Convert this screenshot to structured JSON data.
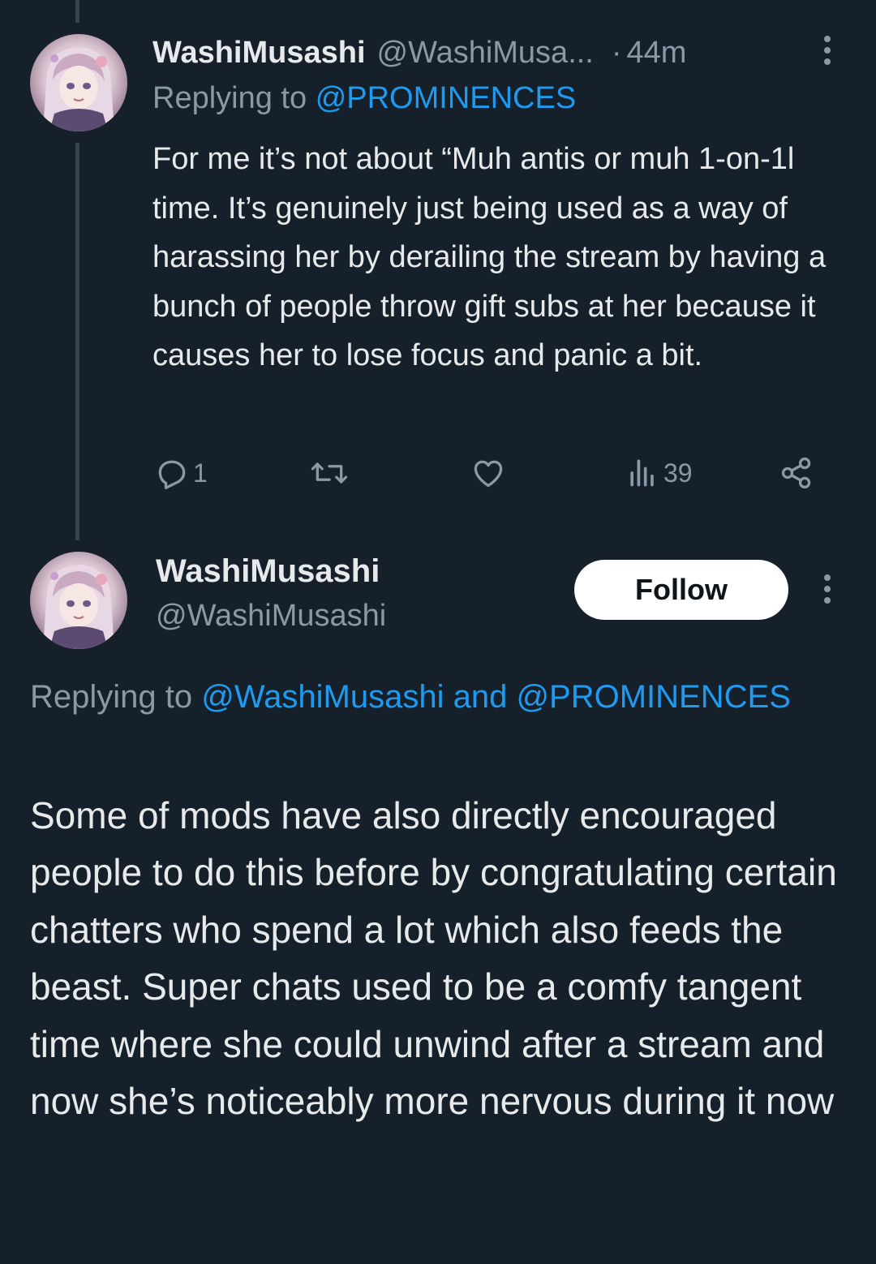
{
  "colors": {
    "background": "#15202b",
    "text_primary": "#e7e9ea",
    "text_secondary": "#8b98a5",
    "accent": "#1d9bf0",
    "thread_line": "#38444d",
    "follow_button_bg": "#ffffff"
  },
  "tweet1": {
    "display_name": "WashiMusashi",
    "handle": "@WashiMusa...",
    "separator": "·",
    "time": "44m",
    "replying_prefix": "Replying to",
    "replying_mention": "@PROMINENCES",
    "body": "For me it’s not about “Muh antis or muh 1-on-1l time. It’s genuinely just being used as a way of harassing her by derailing the stream by having a bunch of people throw gift subs at her because it causes her to lose focus and panic a bit.",
    "actions": {
      "reply_count": "1",
      "retweet_count": "",
      "like_count": "",
      "views_count": "39"
    },
    "icons": [
      "avatar",
      "kebab-menu-icon",
      "reply-icon",
      "retweet-icon",
      "like-icon",
      "views-icon",
      "share-icon"
    ]
  },
  "tweet2": {
    "display_name": "WashiMusashi",
    "handle": "@WashiMusashi",
    "follow_label": "Follow",
    "replying_prefix": "Replying to",
    "replying_mention_1": "@WashiMusashi",
    "replying_joiner": "and",
    "replying_mention_2": "@PROMINENCES",
    "body": "Some of mods have also directly encouraged people to do this before by congratulating certain chatters who spend a lot which also feeds the beast. Super chats used to be a comfy tangent time where she could unwind after a stream and now she’s noticeably more nervous during it now"
  }
}
